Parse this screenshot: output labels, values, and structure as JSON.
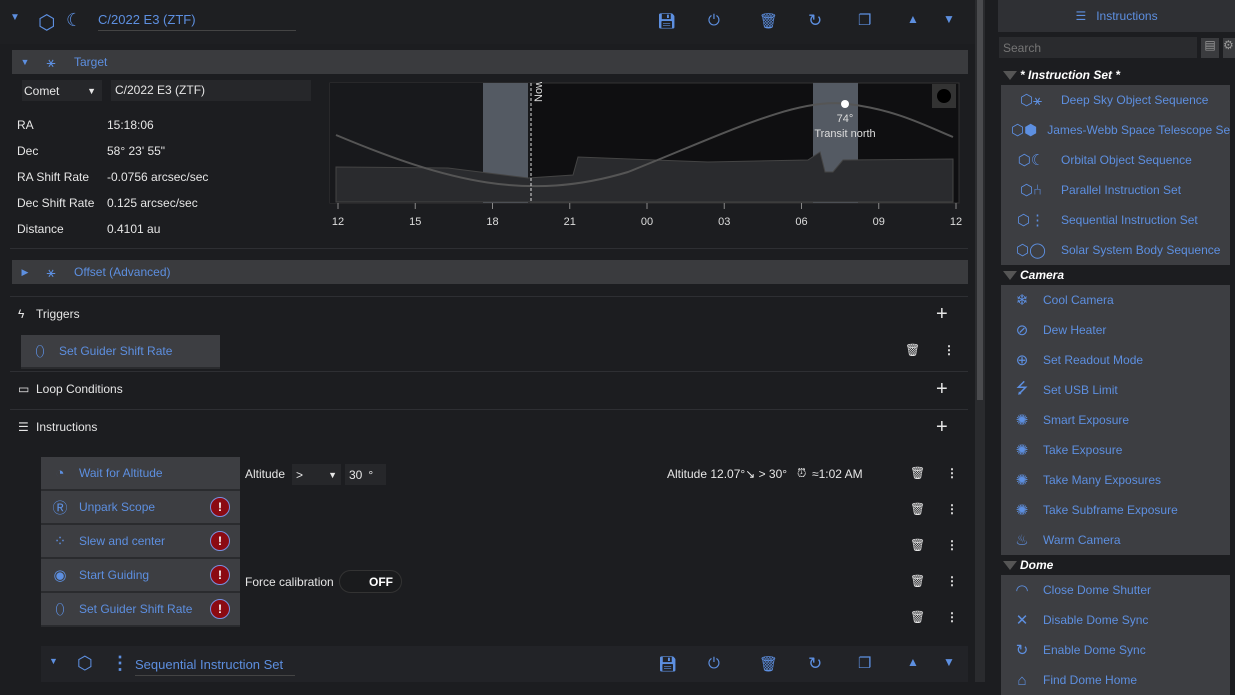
{
  "sequence": {
    "title": "C/2022 E3 (ZTF)"
  },
  "target": {
    "header": "Target",
    "type": "Comet",
    "name": "C/2022 E3 (ZTF)",
    "fields": [
      {
        "label": "RA",
        "value": "15:18:06"
      },
      {
        "label": "Dec",
        "value": "58° 23' 55\""
      },
      {
        "label": "RA Shift Rate",
        "value": "-0.0756 arcsec/sec"
      },
      {
        "label": "Dec Shift Rate",
        "value": "0.125 arcsec/sec"
      },
      {
        "label": "Distance",
        "value": "0.4101 au"
      }
    ]
  },
  "chart_data": {
    "type": "line",
    "x_ticks": [
      "12",
      "15",
      "18",
      "21",
      "00",
      "03",
      "06",
      "09",
      "12"
    ],
    "now_label": "Now",
    "transit_altitude": "74°",
    "transit_label": "Transit north"
  },
  "offset": {
    "header": "Offset (Advanced)"
  },
  "triggers": {
    "header": "Triggers",
    "items": [
      "Set Guider Shift Rate"
    ]
  },
  "loop": {
    "header": "Loop Conditions"
  },
  "instructions": {
    "header": "Instructions",
    "items": [
      {
        "label": "Wait for Altitude",
        "error": false
      },
      {
        "label": "Unpark Scope",
        "error": true
      },
      {
        "label": "Slew and center",
        "error": true
      },
      {
        "label": "Start Guiding",
        "error": true
      },
      {
        "label": "Set Guider Shift Rate",
        "error": true
      }
    ],
    "altitude_label": "Altitude",
    "comparator": ">",
    "altitude_value": "30",
    "degree": "°",
    "status": "Altitude  12.07°↘ > 30°",
    "eta": "≈1:02 AM",
    "force_calibration": "Force calibration",
    "toggle": "OFF",
    "error_mark": "!"
  },
  "next_set": {
    "title": "Sequential Instruction Set"
  },
  "sidebar": {
    "title": "Instructions",
    "search_placeholder": "Search",
    "categories": [
      {
        "name": "* Instruction Set *",
        "items": [
          "Deep Sky Object Sequence",
          "James-Webb Space Telescope Sequence",
          "Orbital Object Sequence",
          "Parallel Instruction Set",
          "Sequential Instruction Set",
          "Solar System Body Sequence"
        ]
      },
      {
        "name": "Camera",
        "items": [
          "Cool Camera",
          "Dew Heater",
          "Set Readout Mode",
          "Set USB Limit",
          "Smart Exposure",
          "Take Exposure",
          "Take Many Exposures",
          "Take Subframe Exposure",
          "Warm Camera"
        ]
      },
      {
        "name": "Dome",
        "items": [
          "Close Dome Shutter",
          "Disable Dome Sync",
          "Enable Dome Sync",
          "Find Dome Home"
        ]
      }
    ]
  },
  "colors": {
    "accent": "#5d8fe0",
    "error": "#8b0a12",
    "background": "#1c1d20"
  }
}
